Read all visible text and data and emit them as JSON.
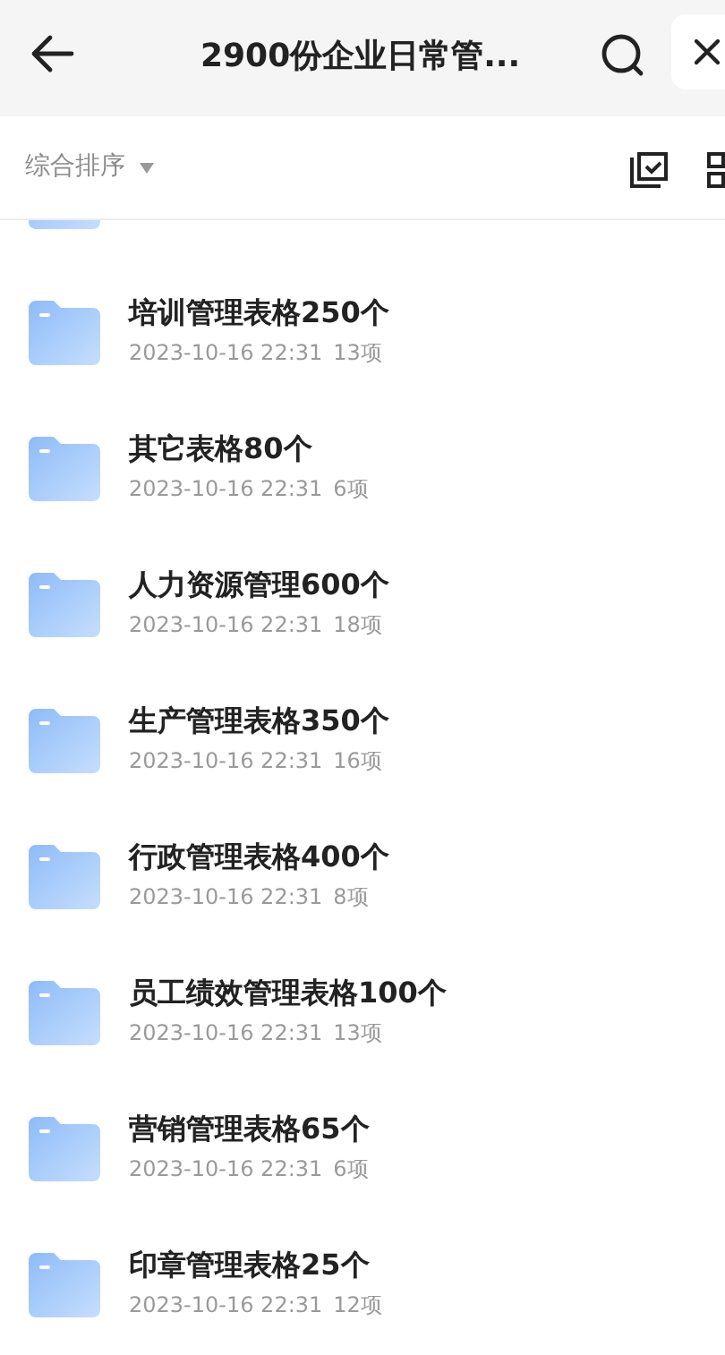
{
  "header": {
    "title": "2900份企业日常管..."
  },
  "sort": {
    "label": "综合排序"
  },
  "folders": [
    {
      "name": "培训管理表格250个",
      "date": "2023-10-16 22:31",
      "count": "13项"
    },
    {
      "name": "其它表格80个",
      "date": "2023-10-16 22:31",
      "count": "6项"
    },
    {
      "name": "人力资源管理600个",
      "date": "2023-10-16 22:31",
      "count": "18项"
    },
    {
      "name": "生产管理表格350个",
      "date": "2023-10-16 22:31",
      "count": "16项"
    },
    {
      "name": "行政管理表格400个",
      "date": "2023-10-16 22:31",
      "count": "8项"
    },
    {
      "name": "员工绩效管理表格100个",
      "date": "2023-10-16 22:31",
      "count": "13项"
    },
    {
      "name": "营销管理表格65个",
      "date": "2023-10-16 22:31",
      "count": "6项"
    },
    {
      "name": "印章管理表格25个",
      "date": "2023-10-16 22:31",
      "count": "12项"
    }
  ]
}
